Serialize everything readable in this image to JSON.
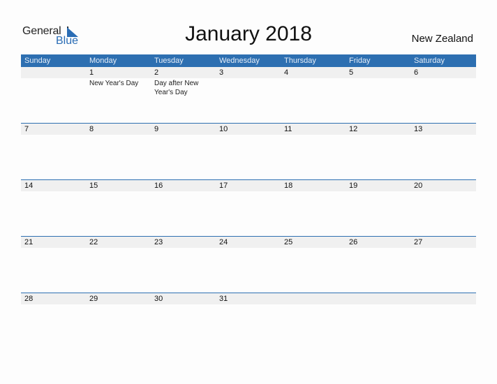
{
  "logo": {
    "line1": "General",
    "line2": "Blue",
    "icon": "triangle-flag-icon"
  },
  "title": "January 2018",
  "country": "New Zealand",
  "colors": {
    "accent": "#2d6fb1",
    "date_strip": "#f0f0f0"
  },
  "weekdays": [
    "Sunday",
    "Monday",
    "Tuesday",
    "Wednesday",
    "Thursday",
    "Friday",
    "Saturday"
  ],
  "weeks": [
    {
      "days": [
        {
          "num": "",
          "event": ""
        },
        {
          "num": "1",
          "event": "New Year's Day"
        },
        {
          "num": "2",
          "event": "Day after New Year's Day"
        },
        {
          "num": "3",
          "event": ""
        },
        {
          "num": "4",
          "event": ""
        },
        {
          "num": "5",
          "event": ""
        },
        {
          "num": "6",
          "event": ""
        }
      ]
    },
    {
      "days": [
        {
          "num": "7",
          "event": ""
        },
        {
          "num": "8",
          "event": ""
        },
        {
          "num": "9",
          "event": ""
        },
        {
          "num": "10",
          "event": ""
        },
        {
          "num": "11",
          "event": ""
        },
        {
          "num": "12",
          "event": ""
        },
        {
          "num": "13",
          "event": ""
        }
      ]
    },
    {
      "days": [
        {
          "num": "14",
          "event": ""
        },
        {
          "num": "15",
          "event": ""
        },
        {
          "num": "16",
          "event": ""
        },
        {
          "num": "17",
          "event": ""
        },
        {
          "num": "18",
          "event": ""
        },
        {
          "num": "19",
          "event": ""
        },
        {
          "num": "20",
          "event": ""
        }
      ]
    },
    {
      "days": [
        {
          "num": "21",
          "event": ""
        },
        {
          "num": "22",
          "event": ""
        },
        {
          "num": "23",
          "event": ""
        },
        {
          "num": "24",
          "event": ""
        },
        {
          "num": "25",
          "event": ""
        },
        {
          "num": "26",
          "event": ""
        },
        {
          "num": "27",
          "event": ""
        }
      ]
    },
    {
      "days": [
        {
          "num": "28",
          "event": ""
        },
        {
          "num": "29",
          "event": ""
        },
        {
          "num": "30",
          "event": ""
        },
        {
          "num": "31",
          "event": ""
        },
        {
          "num": "",
          "event": ""
        },
        {
          "num": "",
          "event": ""
        },
        {
          "num": "",
          "event": ""
        }
      ]
    }
  ]
}
